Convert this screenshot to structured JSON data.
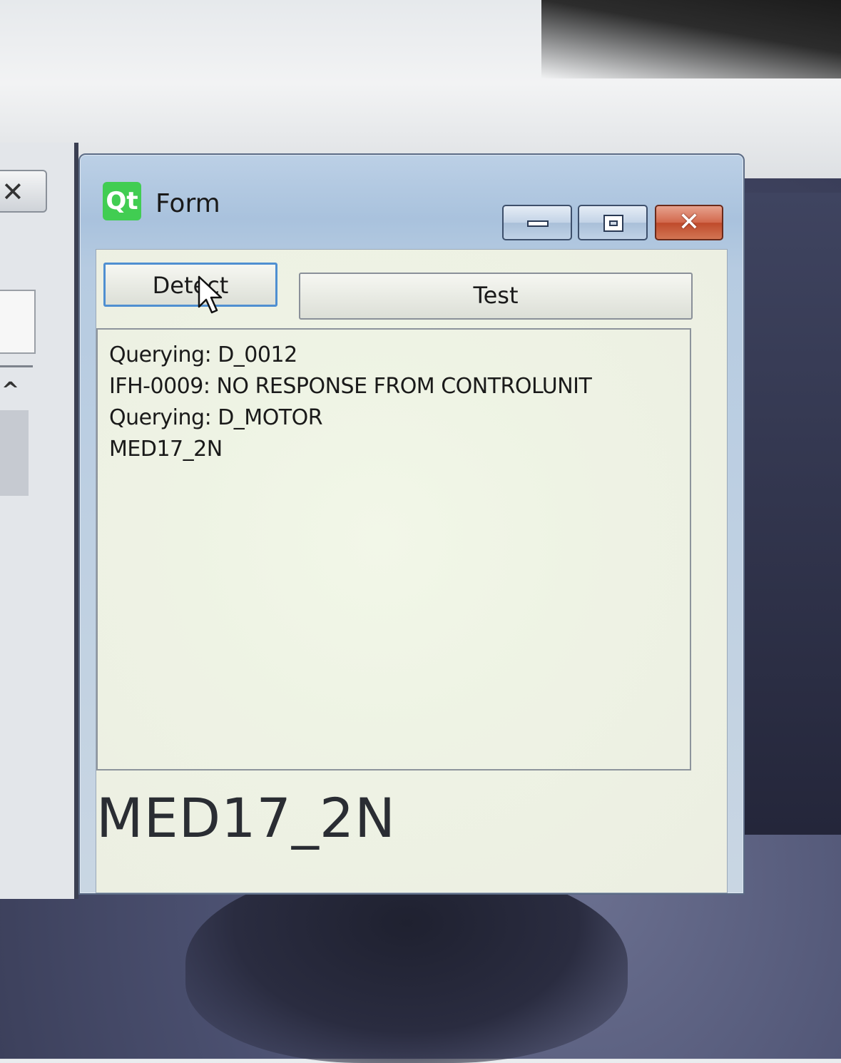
{
  "window": {
    "title": "Form",
    "logo_text": "Qt",
    "close_glyph": "✕"
  },
  "buttons": {
    "detect_label": "Detect",
    "test_label": "Test"
  },
  "log": {
    "lines": [
      "Querying: D_0012",
      "IFH-0009: NO RESPONSE FROM CONTROLUNIT",
      "Querying: D_MOTOR",
      "MED17_2N"
    ]
  },
  "result": {
    "label": "MED17_2N"
  },
  "background_window": {
    "close_glyph": "✕",
    "caret_glyph": "^"
  },
  "colors": {
    "qt_green": "#41cd52",
    "close_red": "#c8502f",
    "focus_blue": "#4f8fd1"
  }
}
